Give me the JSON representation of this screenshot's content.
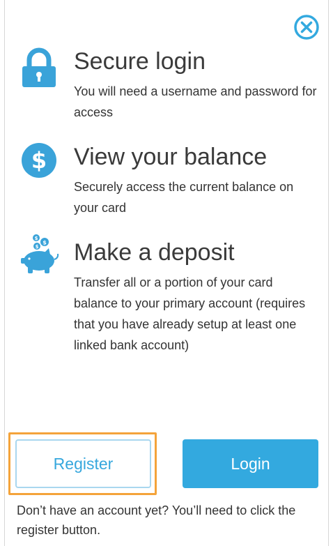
{
  "features": [
    {
      "icon": "lock-icon",
      "title": "Secure login",
      "description": "You will need a username and password for access"
    },
    {
      "icon": "dollar-icon",
      "title": "View your balance",
      "description": "Securely access the current balance on your card"
    },
    {
      "icon": "piggy-bank-icon",
      "title": "Make a deposit",
      "description": "Transfer all or a portion of your card balance to your primary account (requires that you have already setup at least one linked bank account)"
    }
  ],
  "buttons": {
    "register_label": "Register",
    "login_label": "Login"
  },
  "footer_note": "Don’t have an account yet? You’ll need to click the register button.",
  "colors": {
    "accent": "#33a9df",
    "highlight": "#f4a33a"
  },
  "icons": {
    "close": "close-circle-icon"
  }
}
